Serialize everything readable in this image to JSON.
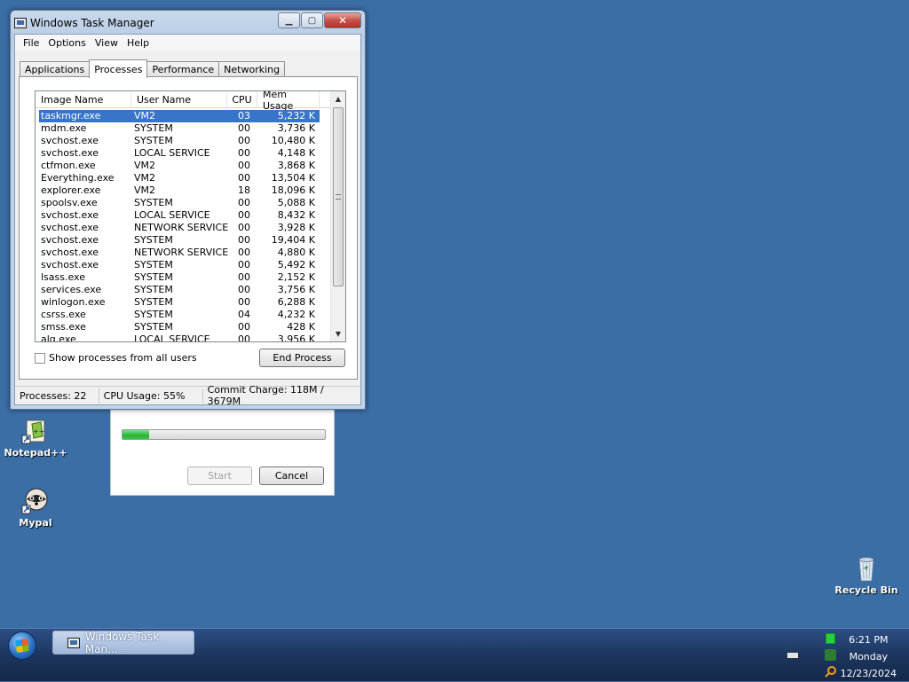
{
  "desktop": {
    "icons": [
      {
        "label": "Notepad++",
        "icon": "notepad-plus-plus-icon"
      },
      {
        "label": "Mypal",
        "icon": "mypal-raccoon-icon"
      },
      {
        "label": "Recycle Bin",
        "icon": "recycle-bin-icon"
      }
    ]
  },
  "installer": {
    "progress_fraction": 0.13,
    "start_label": "Start",
    "cancel_label": "Cancel"
  },
  "task_manager": {
    "title": "Windows Task Manager",
    "menu": [
      "File",
      "Options",
      "View",
      "Help"
    ],
    "tabs": [
      "Applications",
      "Processes",
      "Performance",
      "Networking"
    ],
    "active_tab": "Processes",
    "columns": [
      "Image Name",
      "User Name",
      "CPU",
      "Mem Usage"
    ],
    "processes": [
      {
        "name": "taskmgr.exe",
        "user": "VM2",
        "cpu": "03",
        "mem": "5,232 K"
      },
      {
        "name": "mdm.exe",
        "user": "SYSTEM",
        "cpu": "00",
        "mem": "3,736 K"
      },
      {
        "name": "svchost.exe",
        "user": "SYSTEM",
        "cpu": "00",
        "mem": "10,480 K"
      },
      {
        "name": "svchost.exe",
        "user": "LOCAL SERVICE",
        "cpu": "00",
        "mem": "4,148 K"
      },
      {
        "name": "ctfmon.exe",
        "user": "VM2",
        "cpu": "00",
        "mem": "3,868 K"
      },
      {
        "name": "Everything.exe",
        "user": "VM2",
        "cpu": "00",
        "mem": "13,504 K"
      },
      {
        "name": "explorer.exe",
        "user": "VM2",
        "cpu": "18",
        "mem": "18,096 K"
      },
      {
        "name": "spoolsv.exe",
        "user": "SYSTEM",
        "cpu": "00",
        "mem": "5,088 K"
      },
      {
        "name": "svchost.exe",
        "user": "LOCAL SERVICE",
        "cpu": "00",
        "mem": "8,432 K"
      },
      {
        "name": "svchost.exe",
        "user": "NETWORK SERVICE",
        "cpu": "00",
        "mem": "3,928 K"
      },
      {
        "name": "svchost.exe",
        "user": "SYSTEM",
        "cpu": "00",
        "mem": "19,404 K"
      },
      {
        "name": "svchost.exe",
        "user": "NETWORK SERVICE",
        "cpu": "00",
        "mem": "4,880 K"
      },
      {
        "name": "svchost.exe",
        "user": "SYSTEM",
        "cpu": "00",
        "mem": "5,492 K"
      },
      {
        "name": "lsass.exe",
        "user": "SYSTEM",
        "cpu": "00",
        "mem": "2,152 K"
      },
      {
        "name": "services.exe",
        "user": "SYSTEM",
        "cpu": "00",
        "mem": "3,756 K"
      },
      {
        "name": "winlogon.exe",
        "user": "SYSTEM",
        "cpu": "00",
        "mem": "6,288 K"
      },
      {
        "name": "csrss.exe",
        "user": "SYSTEM",
        "cpu": "04",
        "mem": "4,232 K"
      },
      {
        "name": "smss.exe",
        "user": "SYSTEM",
        "cpu": "00",
        "mem": "428 K"
      },
      {
        "name": "alg.exe",
        "user": "LOCAL SERVICE",
        "cpu": "00",
        "mem": "3,956 K"
      }
    ],
    "selected_index": 0,
    "show_all_label": "Show processes from all users",
    "end_process_label": "End Process",
    "status": {
      "processes": "Processes: 22",
      "cpu": "CPU Usage: 55%",
      "commit": "Commit Charge: 118M / 3679M"
    }
  },
  "taskbar": {
    "task_label": "Windows Task Man...",
    "time": "6:21 PM",
    "day": "Monday",
    "date": "12/23/2024"
  },
  "colors": {
    "desktop": "#3a6ea5",
    "selection": "#3875c8",
    "progress": "#26b533"
  }
}
